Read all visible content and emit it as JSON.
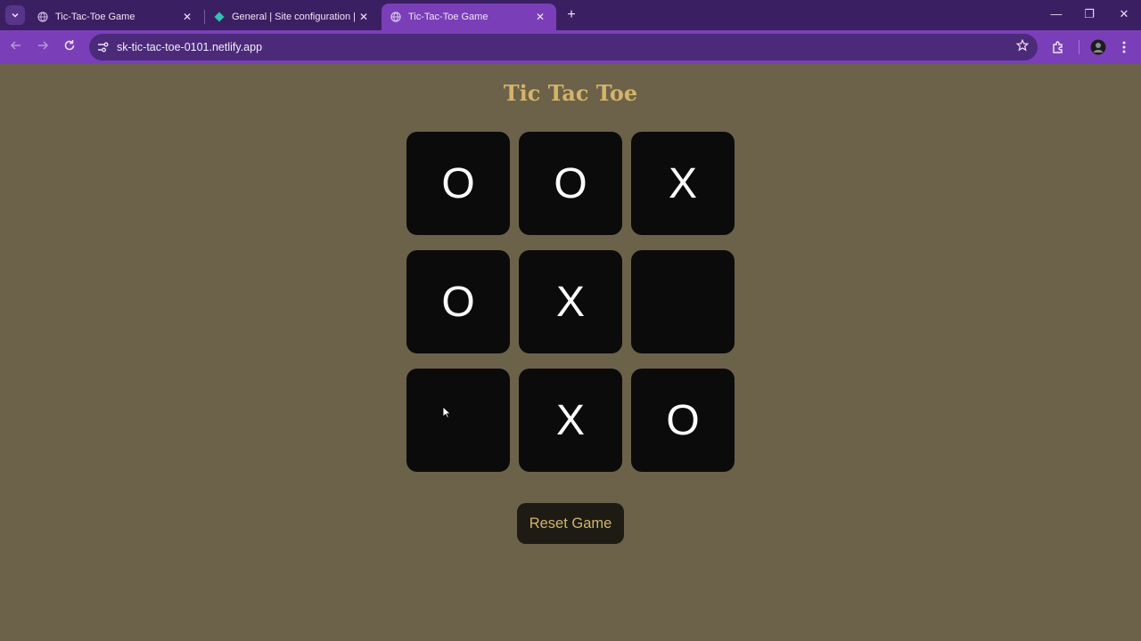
{
  "browser": {
    "tabs": [
      {
        "title": "Tic-Tac-Toe Game",
        "active": false,
        "favicon": "globe-icon"
      },
      {
        "title": "General | Site configuration | ex",
        "active": false,
        "favicon": "netlify-diamond-icon"
      },
      {
        "title": "Tic-Tac-Toe Game",
        "active": true,
        "favicon": "globe-icon"
      }
    ],
    "tab_close_symbol": "✕",
    "new_tab_symbol": "+",
    "url": "sk-tic-tac-toe-0101.netlify.app",
    "window_controls": {
      "minimize": "—",
      "restore": "❐",
      "close": "✕"
    },
    "colors": {
      "tabbar": "#3b1f63",
      "toolbar": "#7a3fb8",
      "omnibox": "#4c2a7a"
    }
  },
  "game": {
    "title": "Tic Tac Toe",
    "board": [
      "O",
      "O",
      "X",
      "O",
      "X",
      "",
      "",
      "X",
      "O"
    ],
    "reset_label": "Reset Game",
    "colors": {
      "background": "#6b6249",
      "cell": "#0b0b0b",
      "title": "#d4b469",
      "reset_bg": "#1d1b13"
    }
  }
}
